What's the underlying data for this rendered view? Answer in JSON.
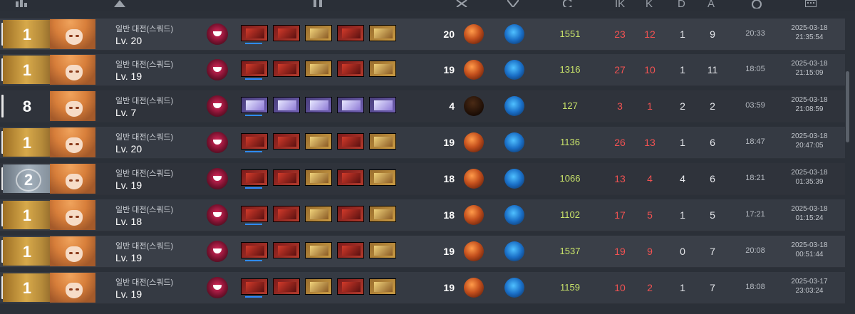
{
  "header": {
    "columns": [
      "rank-icon",
      "character-icon",
      "equipment-icon",
      "kills-icon",
      "skill-icon",
      "score-icon",
      "IK",
      "K",
      "D",
      "A",
      "time-icon",
      "date-icon"
    ],
    "ik_label": "IK",
    "k_label": "K",
    "d_label": "D",
    "a_label": "A"
  },
  "matches": [
    {
      "rank": "1",
      "rank_style": "gold",
      "mode": "일반 대전(스쿼드)",
      "level": "Lv. 20",
      "count": "20",
      "ball": "normal",
      "score": "1551",
      "ik": "23",
      "k": "12",
      "d": "1",
      "a": "9",
      "time": "20:33",
      "date": "2025-03-18",
      "clock": "21:35:54",
      "items": [
        "red",
        "red",
        "gold",
        "red",
        "gold"
      ],
      "highlight": false
    },
    {
      "rank": "1",
      "rank_style": "gold",
      "mode": "일반 대전(스쿼드)",
      "level": "Lv. 19",
      "count": "19",
      "ball": "normal",
      "score": "1316",
      "ik": "27",
      "k": "10",
      "d": "1",
      "a": "11",
      "time": "18:05",
      "date": "2025-03-18",
      "clock": "21:15:09",
      "items": [
        "red",
        "red",
        "gold",
        "red",
        "gold"
      ],
      "highlight": false
    },
    {
      "rank": "8",
      "rank_style": "none",
      "mode": "일반 대전(스쿼드)",
      "level": "Lv. 7",
      "count": "4",
      "ball": "dark",
      "score": "127",
      "ik": "3",
      "k": "1",
      "d": "2",
      "a": "2",
      "time": "03:59",
      "date": "2025-03-18",
      "clock": "21:08:59",
      "items": [
        "purple",
        "purple",
        "purple",
        "purple",
        "purple"
      ],
      "highlight": true
    },
    {
      "rank": "1",
      "rank_style": "gold",
      "mode": "일반 대전(스쿼드)",
      "level": "Lv. 20",
      "count": "19",
      "ball": "normal",
      "score": "1136",
      "ik": "26",
      "k": "13",
      "d": "1",
      "a": "6",
      "time": "18:47",
      "date": "2025-03-18",
      "clock": "20:47:05",
      "items": [
        "red",
        "red",
        "gold",
        "red",
        "gold"
      ],
      "highlight": false
    },
    {
      "rank": "2",
      "rank_style": "silver",
      "mode": "일반 대전(스쿼드)",
      "level": "Lv. 19",
      "count": "18",
      "ball": "normal",
      "score": "1066",
      "ik": "13",
      "k": "4",
      "d": "4",
      "a": "6",
      "time": "18:21",
      "date": "2025-03-18",
      "clock": "01:35:39",
      "items": [
        "red",
        "red",
        "gold",
        "red",
        "gold"
      ],
      "highlight": true
    },
    {
      "rank": "1",
      "rank_style": "gold",
      "mode": "일반 대전(스쿼드)",
      "level": "Lv. 18",
      "count": "18",
      "ball": "normal",
      "score": "1102",
      "ik": "17",
      "k": "5",
      "d": "1",
      "a": "5",
      "time": "17:21",
      "date": "2025-03-18",
      "clock": "01:15:24",
      "items": [
        "red",
        "red",
        "gold",
        "red",
        "gold"
      ],
      "highlight": false
    },
    {
      "rank": "1",
      "rank_style": "gold",
      "mode": "일반 대전(스쿼드)",
      "level": "Lv. 19",
      "count": "19",
      "ball": "normal",
      "score": "1537",
      "ik": "19",
      "k": "9",
      "d": "0",
      "a": "7",
      "time": "20:08",
      "date": "2025-03-18",
      "clock": "00:51:44",
      "items": [
        "red",
        "red",
        "gold",
        "red",
        "gold"
      ],
      "highlight": false
    },
    {
      "rank": "1",
      "rank_style": "gold",
      "mode": "일반 대전(스쿼드)",
      "level": "Lv. 19",
      "count": "19",
      "ball": "normal",
      "score": "1159",
      "ik": "10",
      "k": "2",
      "d": "1",
      "a": "7",
      "time": "18:08",
      "date": "2025-03-17",
      "clock": "23:03:24",
      "items": [
        "red",
        "red",
        "gold",
        "red",
        "gold"
      ],
      "highlight": false
    }
  ]
}
